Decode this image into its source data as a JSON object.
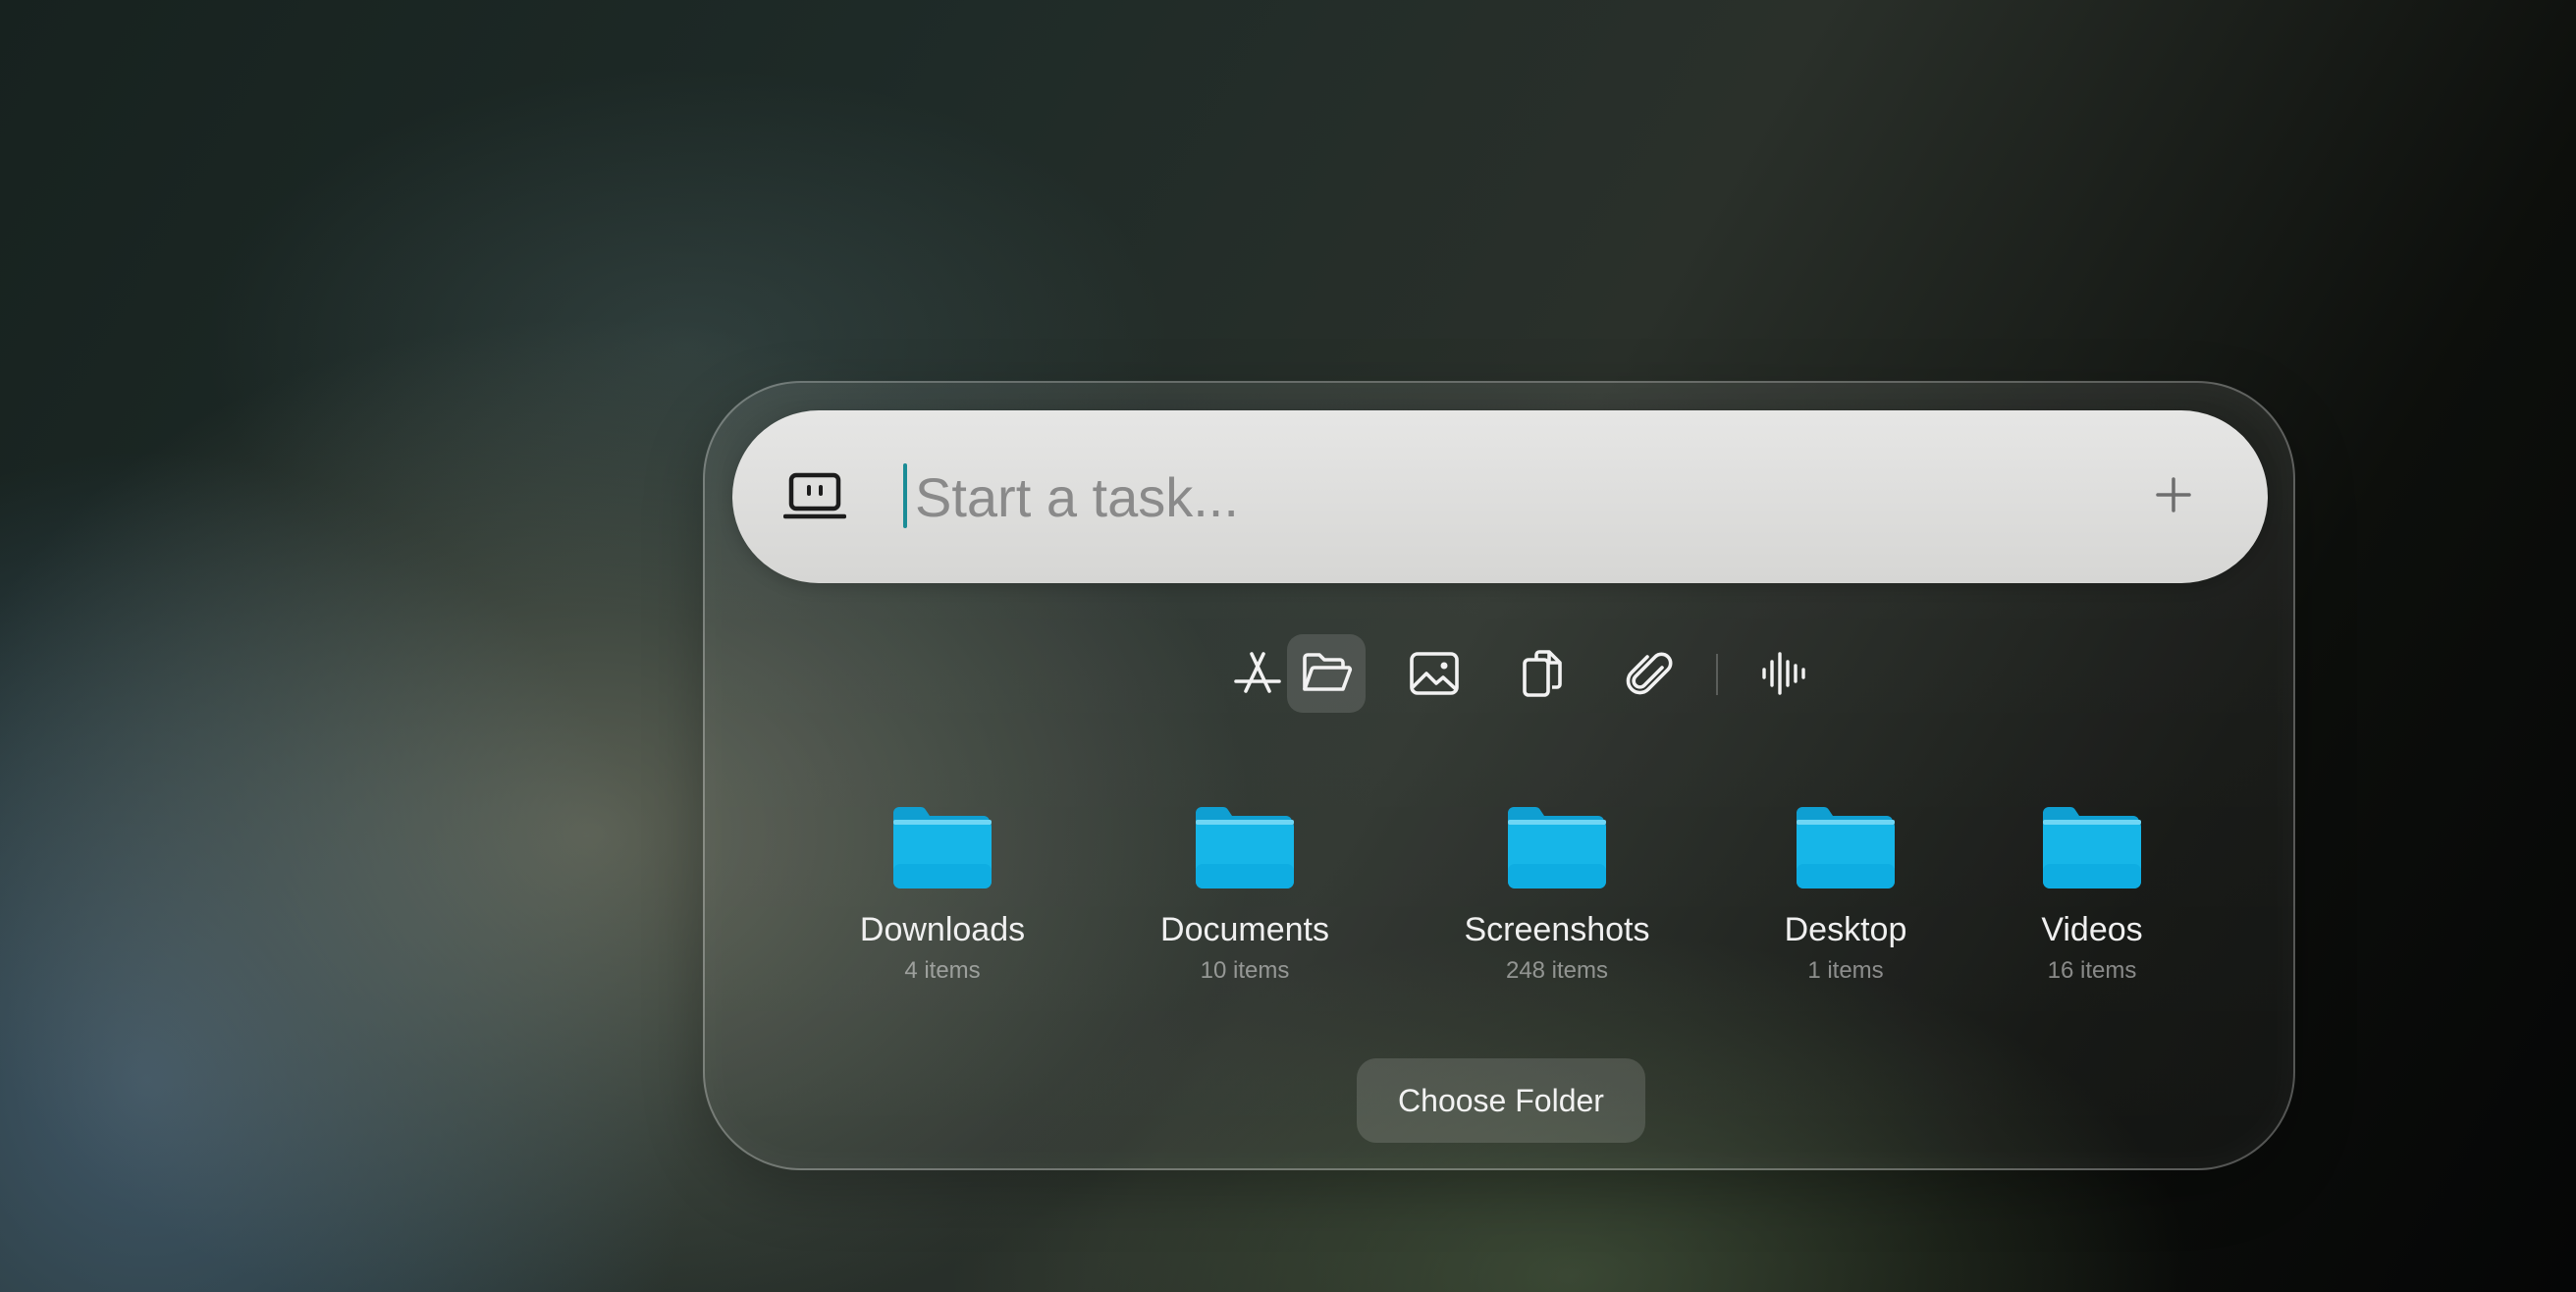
{
  "search": {
    "placeholder": "Start a task...",
    "value": ""
  },
  "toolbar": {
    "tools": [
      {
        "name": "app-store-icon",
        "active": false
      },
      {
        "name": "folder-open-icon",
        "active": true
      },
      {
        "name": "image-icon",
        "active": false
      },
      {
        "name": "copy-icon",
        "active": false
      },
      {
        "name": "paperclip-icon",
        "active": false
      },
      {
        "name": "audio-waveform-icon",
        "active": false
      }
    ]
  },
  "folders": [
    {
      "name": "Downloads",
      "count": "4 items"
    },
    {
      "name": "Documents",
      "count": "10 items"
    },
    {
      "name": "Screenshots",
      "count": "248 items"
    },
    {
      "name": "Desktop",
      "count": "1 items"
    },
    {
      "name": "Videos",
      "count": "16 items"
    }
  ],
  "choose_folder_label": "Choose Folder",
  "colors": {
    "folder": "#14b4e6",
    "caret": "#1a8c96",
    "search_bar": "#dcdcda"
  }
}
